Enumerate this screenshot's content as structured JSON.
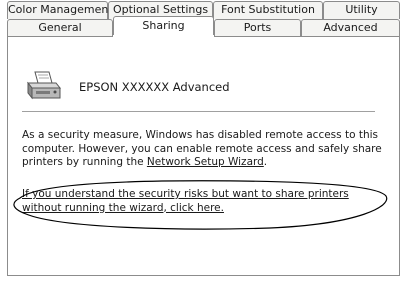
{
  "tabs_back": [
    {
      "label": "Color Management"
    },
    {
      "label": "Optional Settings"
    },
    {
      "label": "Font Substitution"
    },
    {
      "label": "Utility"
    }
  ],
  "tabs_front": [
    {
      "label": "General"
    },
    {
      "label": "Sharing"
    },
    {
      "label": "Ports"
    },
    {
      "label": "Advanced"
    }
  ],
  "active_tab": "Sharing",
  "printer": {
    "name": "EPSON XXXXXX Advanced",
    "icon": "printer-icon"
  },
  "security_text": {
    "before_link1": "As a security measure, Windows has disabled remote access to this computer. However, you can enable remote access and safely share printers by running the ",
    "link1": "Network Setup Wizard",
    "after_link1": "."
  },
  "share_link": "If you understand the security risks but want to share printers without running the wizard, click here.",
  "annotation": {
    "shape": "ellipse",
    "color": "#000000"
  }
}
